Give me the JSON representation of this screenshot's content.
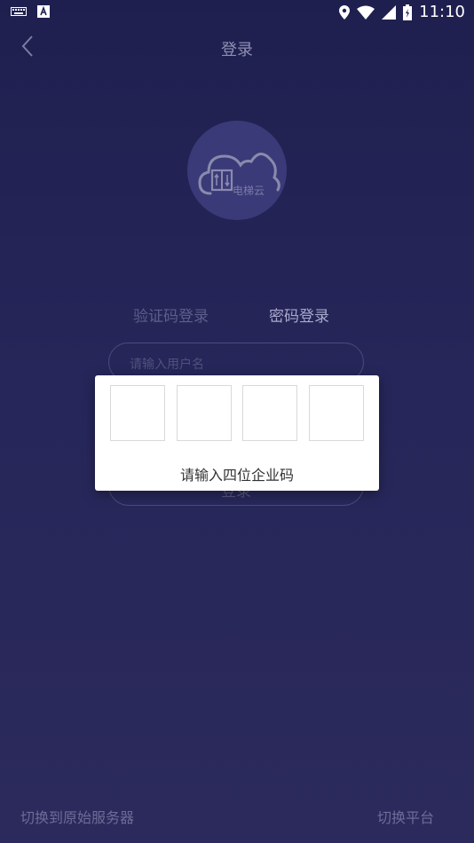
{
  "status_bar": {
    "time": "11:10"
  },
  "header": {
    "title": "登录"
  },
  "logo": {
    "text": "电梯云"
  },
  "tabs": [
    {
      "label": "验证码登录"
    },
    {
      "label": "密码登录"
    }
  ],
  "form": {
    "username_placeholder": "请输入用户名",
    "login_label": "登录"
  },
  "dialog": {
    "label": "请输入四位企业码",
    "codes": [
      "",
      "",
      "",
      ""
    ]
  },
  "footer": {
    "switch_server": "切换到原始服务器",
    "switch_platform": "切换平台"
  }
}
